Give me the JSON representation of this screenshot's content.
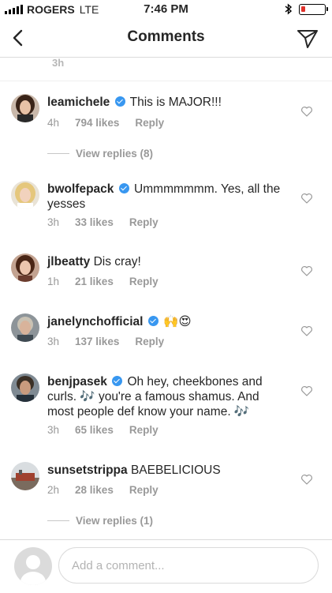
{
  "status_bar": {
    "carrier": "ROGERS",
    "network": "LTE",
    "time": "7:46 PM",
    "battery_level": 0.18,
    "battery_color": "#e0312b"
  },
  "header": {
    "title": "Comments"
  },
  "previous_comment": {
    "time": "3h"
  },
  "comments": [
    {
      "username": "leamichele",
      "verified": true,
      "text": "This is MAJOR!!!",
      "time": "4h",
      "likes": "794 likes",
      "reply": "Reply"
    },
    {
      "username": "bwolfepack",
      "verified": true,
      "text": "Ummmmmmm. Yes, all the yesses",
      "time": "3h",
      "likes": "33 likes",
      "reply": "Reply"
    },
    {
      "username": "jlbeatty",
      "verified": false,
      "text": "Dis cray!",
      "time": "1h",
      "likes": "21 likes",
      "reply": "Reply"
    },
    {
      "username": "janelynchofficial",
      "verified": true,
      "text": "🙌😍",
      "time": "3h",
      "likes": "137 likes",
      "reply": "Reply"
    },
    {
      "username": "benjpasek",
      "verified": true,
      "text": "Oh hey, cheekbones and curls. 🎶 you're a famous shamus. And most people def know your name. 🎶",
      "time": "3h",
      "likes": "65 likes",
      "reply": "Reply"
    },
    {
      "username": "sunsetstrippa",
      "verified": false,
      "text": "BAEBELICIOUS",
      "time": "2h",
      "likes": "28 likes",
      "reply": "Reply"
    }
  ],
  "view_replies": {
    "first": "View replies (8)",
    "last": "View replies (1)"
  },
  "composer": {
    "placeholder": "Add a comment..."
  },
  "colors": {
    "accent": "#3897f0",
    "muted": "#999999",
    "divider": "#dbdbdb"
  }
}
